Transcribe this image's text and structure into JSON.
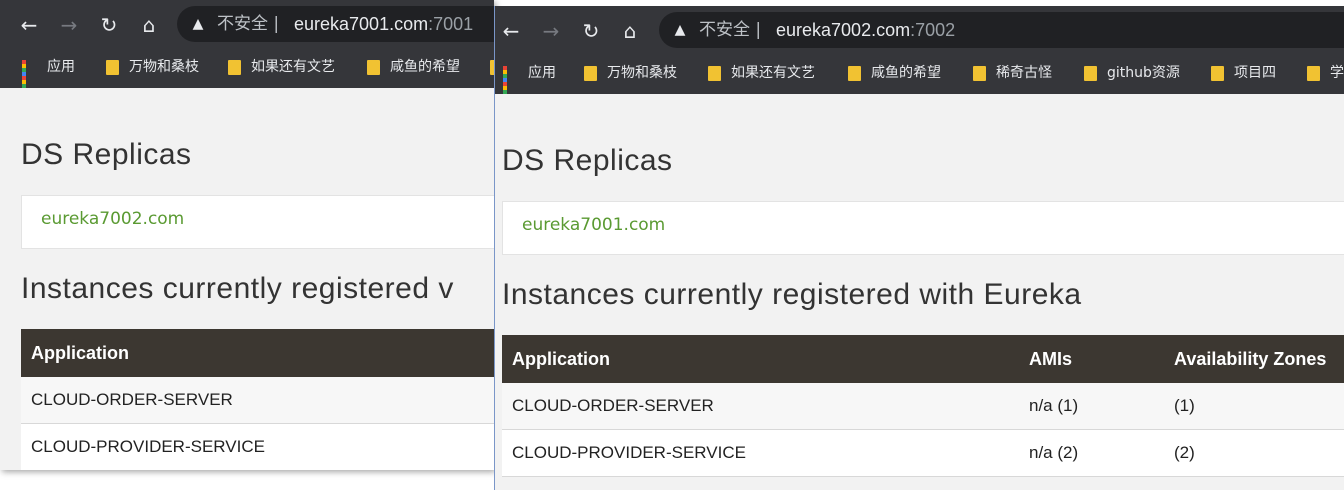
{
  "colors": {
    "toolbar": "#35363a",
    "omnibox": "#202124",
    "table_header": "#3c3731",
    "link": "#5a9a32",
    "page_bg": "#f2f2f2"
  },
  "windows": [
    {
      "nav": {
        "back_icon": "←",
        "forward_icon": "→",
        "reload_icon": "↻",
        "home_icon": "⌂"
      },
      "address": {
        "security_label": "不安全 |",
        "host": "eureka7001.com",
        "port": ":7001"
      },
      "bookmarks": [
        "应用",
        "万物和桑枝",
        "如果还有文艺",
        "咸鱼的希望"
      ],
      "page": {
        "replicas_title": "DS Replicas",
        "replica_link": "eureka7002.com",
        "instances_title": "Instances currently registered v",
        "table": {
          "headers": [
            "Application"
          ],
          "rows": [
            [
              "CLOUD-ORDER-SERVER"
            ],
            [
              "CLOUD-PROVIDER-SERVICE"
            ]
          ]
        }
      }
    },
    {
      "nav": {
        "back_icon": "←",
        "forward_icon": "→",
        "reload_icon": "↻",
        "home_icon": "⌂"
      },
      "address": {
        "security_label": "不安全 |",
        "host": "eureka7002.com",
        "port": ":7002"
      },
      "bookmarks": [
        "应用",
        "万物和桑枝",
        "如果还有文艺",
        "咸鱼的希望",
        "稀奇古怪",
        "github资源",
        "项目四",
        "学"
      ],
      "page": {
        "replicas_title": "DS Replicas",
        "replica_link": "eureka7001.com",
        "instances_title": "Instances currently registered with Eureka",
        "table": {
          "headers": [
            "Application",
            "AMIs",
            "Availability Zones"
          ],
          "rows": [
            [
              "CLOUD-ORDER-SERVER",
              "n/a (1)",
              "(1)"
            ],
            [
              "CLOUD-PROVIDER-SERVICE",
              "n/a (2)",
              "(2)"
            ]
          ]
        }
      }
    }
  ]
}
